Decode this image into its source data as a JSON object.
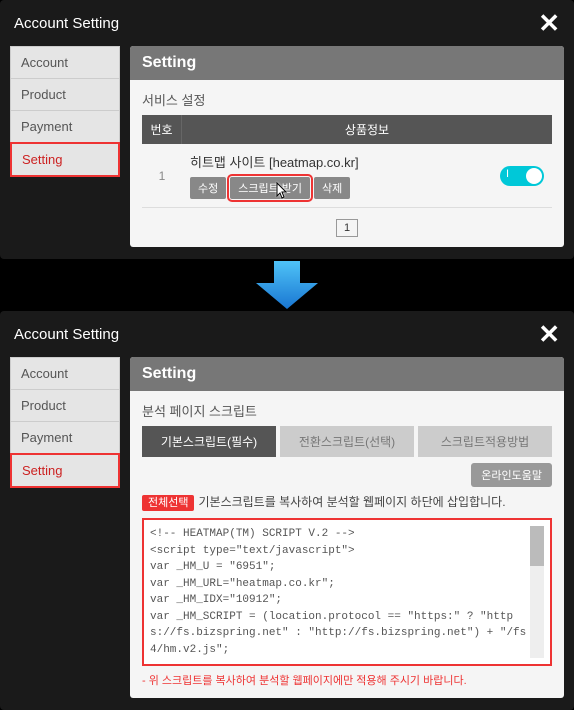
{
  "window_title": "Account Setting",
  "sidebar": {
    "items": [
      {
        "label": "Account"
      },
      {
        "label": "Product"
      },
      {
        "label": "Payment"
      },
      {
        "label": "Setting"
      }
    ]
  },
  "top": {
    "header": "Setting",
    "section_title": "서비스 설정",
    "col_num": "번호",
    "col_info": "상품정보",
    "row": {
      "num": "1",
      "site": "히트맵 사이트 [heatmap.co.kr]",
      "btn_edit": "수정",
      "btn_script": "스크립트 받기",
      "btn_delete": "삭제",
      "toggle_state": "I"
    },
    "page": "1"
  },
  "bottom": {
    "header": "Setting",
    "section_title": "분석 페이지 스크립트",
    "tabs": [
      {
        "label": "기본스크립트(필수)"
      },
      {
        "label": "전환스크립트(선택)"
      },
      {
        "label": "스크립트적용방법"
      }
    ],
    "help_btn": "온라인도움말",
    "badge": "전체선택",
    "notice": "기본스크립트를 복사하여 분석할 웹페이지 하단에 삽입합니다.",
    "script": "<!-- HEATMAP(TM) SCRIPT V.2 -->\n<script type=\"text/javascript\">\nvar _HM_U = \"6951\";\nvar _HM_URL=\"heatmap.co.kr\";\nvar _HM_IDX=\"10912\";\nvar _HM_SCRIPT = (location.protocol == \"https:\" ? \"https://fs.bizspring.net\" : \"http://fs.bizspring.net\") + \"/fs4/hm.v2.js\";",
    "warn": "- 위 스크립트를 복사하여 분석할 웹페이지에만 적용해 주시기 바랍니다."
  }
}
